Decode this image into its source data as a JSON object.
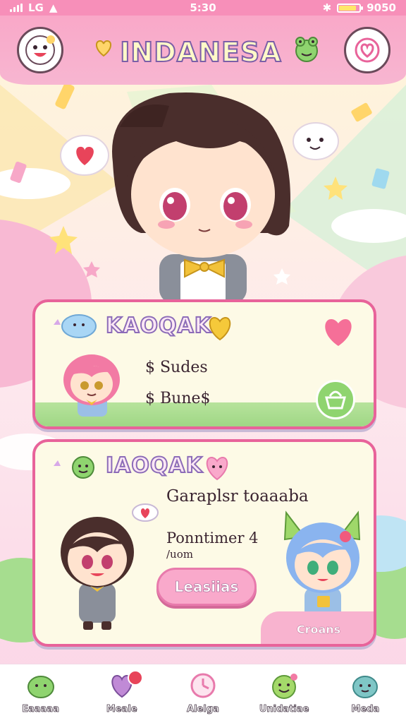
{
  "status_bar": {
    "time": "5:30",
    "left_label": "LG",
    "right_label": "9050"
  },
  "header": {
    "title": "INDANESA",
    "left_icon": "smiley-icon",
    "right_icon": "heart-icon"
  },
  "card1": {
    "title": "KAOQAK",
    "line1": "$ Sudes",
    "line2": "$ Bune$",
    "action_icon": "basket-icon"
  },
  "card2": {
    "title": "IAOQAK",
    "heading": "Garaplsr toaaaba",
    "line1": "Ponntimer 4",
    "line2": "/uom",
    "button_label": "Leasiias",
    "corner_button_label": "Croans"
  },
  "bottom_nav": {
    "items": [
      {
        "label": "Eaaaaa",
        "icon": "green-blob-icon",
        "color": "#8fd46f"
      },
      {
        "label": "Meale",
        "icon": "heart-chat-icon",
        "color": "#c08ad6"
      },
      {
        "label": "Alelga",
        "icon": "clock-icon",
        "color": "#f49ac1"
      },
      {
        "label": "Unidatiae",
        "icon": "smile-face-icon",
        "color": "#a4d96a"
      },
      {
        "label": "Meda",
        "icon": "teal-face-icon",
        "color": "#7fc6c6"
      }
    ]
  },
  "colors": {
    "accent_pink": "#e8639a",
    "card_bg": "#fdfae6",
    "status_bar": "#f78fb9"
  }
}
